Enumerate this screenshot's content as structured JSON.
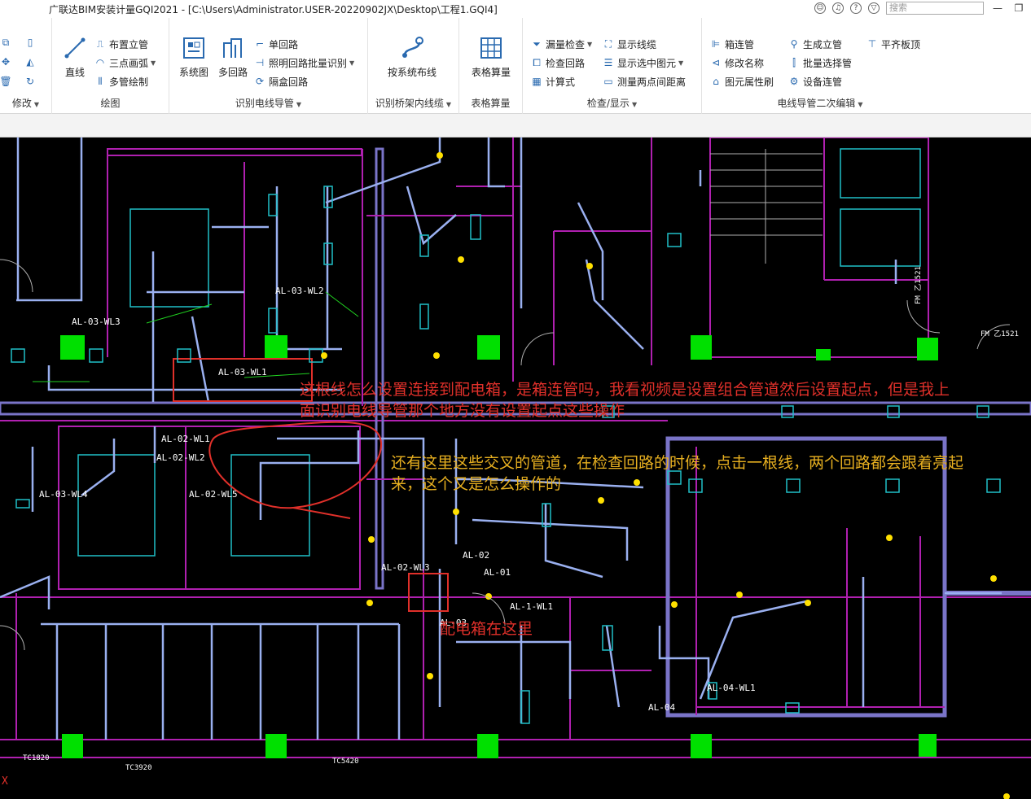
{
  "window": {
    "title": "广联达BIM安装计量GQI2021 - [C:\\Users\\Administrator.USER-20220902JX\\Desktop\\工程1.GQI4]",
    "search_placeholder": "搜索"
  },
  "ribbon": {
    "groups": {
      "modify": {
        "label": "修改"
      },
      "draw": {
        "label": "绘图",
        "line": "直线",
        "arrange_riser": "布置立管",
        "three_point_arc": "三点画弧",
        "multi_pipe_draw": "多管绘制"
      },
      "identify": {
        "label": "识别电线导管",
        "system_diagram": "系统图",
        "multi_circuit": "多回路",
        "single_circuit": "单回路",
        "lighting_batch": "照明回路批量识别",
        "box_circuit": "隔盒回路"
      },
      "tray": {
        "label": "识别桥架内线缆",
        "by_system": "按系统布线"
      },
      "table": {
        "label": "表格算量",
        "table_calc": "表格算量"
      },
      "check": {
        "label": "检查/显示",
        "leak_check": "漏量检查",
        "check_circuit": "检查回路",
        "calc_formula": "计算式",
        "show_wires": "显示线缆",
        "show_selected": "显示选中图元",
        "measure_distance": "测量两点间距离"
      },
      "secondary": {
        "label": "电线导管二次编辑",
        "box_pipe": "箱连管",
        "rename": "修改名称",
        "prop_brush": "图元属性刷",
        "gen_riser": "生成立管",
        "batch_select": "批量选择管",
        "device_pipe": "设备连管",
        "flush_top": "平齐板顶"
      }
    }
  },
  "annotations": {
    "q1_line1": "这根线怎么设置连接到配电箱，是箱连管吗，我看视频是设置组合管道然后设置起点，但是我上",
    "q1_line2": "面识别电线导管那个地方没有设置起点这些操作",
    "q2_line1": "还有这里这些交叉的管道，在检查回路的时候，点击一根线，两个回路都会跟着亮起",
    "q2_line2": "来，这个又是怎么操作的",
    "panel_here": "配电箱在这里"
  },
  "drawing_labels": {
    "al03wl3": "AL-03-WL3",
    "al03wl2": "AL-03-WL2",
    "al03wl1": "AL-03-WL1",
    "al02wl1": "AL-02-WL1",
    "al02wl2": "AL-02-WL2",
    "al03wl4": "AL-03-WL4",
    "al02wl5": "AL-02-WL5",
    "al02wl3": "AL-02-WL3",
    "al02": "AL-02",
    "al01": "AL-01",
    "al03": "AL-03",
    "al04wl1": "AL-04-WL1",
    "al04": "AL-04",
    "alwl1": "AL-1-WL1",
    "tc1820": "TC1820",
    "tc3920": "TC3920",
    "tc5420": "TC5420",
    "fm1521": "FM 乙1521",
    "fm1521b": "FM 乙1521",
    "axis_x": "X"
  },
  "colors": {
    "wall": "#b020b0",
    "conduit": "#9ab0f0",
    "green_column": "#00e000",
    "cyan": "#20c0c8",
    "annotation_red": "#e0302a",
    "annotation_yellow": "#e8b020"
  }
}
